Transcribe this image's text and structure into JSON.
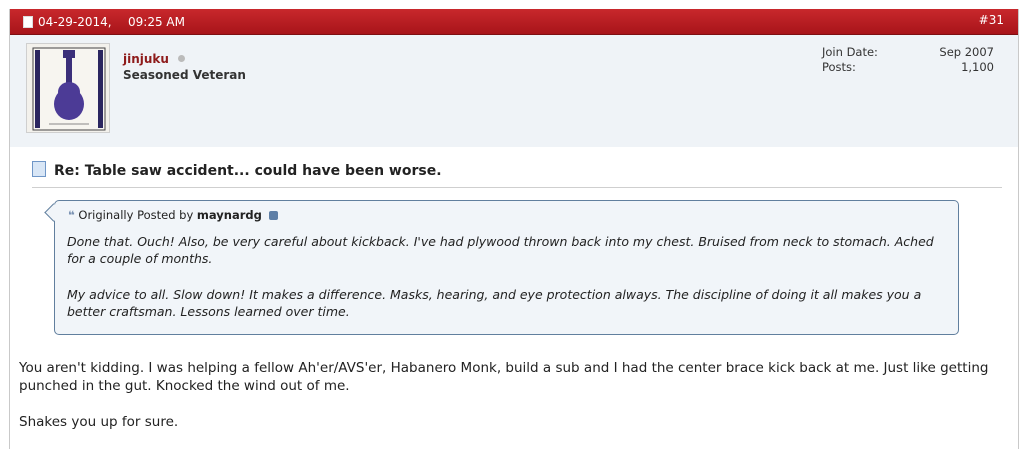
{
  "post": {
    "date": "04-29-2014,",
    "time": "09:25 AM",
    "number": "#31"
  },
  "user": {
    "name": "jinjuku",
    "title": "Seasoned Veteran",
    "stats": [
      {
        "label": "Join Date:",
        "value": "Sep 2007"
      },
      {
        "label": "Posts:",
        "value": "1,100"
      }
    ]
  },
  "thread_title": "Re: Table saw accident... could have been worse.",
  "quote": {
    "prefix": "Originally Posted by",
    "author": "maynardg",
    "paragraphs": [
      "Done that. Ouch! Also, be very careful about kickback. I've had plywood thrown back into my chest. Bruised from neck to stomach. Ached for a couple of months.",
      "My advice to all. Slow down! It makes a difference. Masks, hearing, and eye protection always. The discipline of doing it all makes you a better craftsman. Lessons learned over time."
    ]
  },
  "message": {
    "paragraphs": [
      "You aren't kidding. I was helping a fellow Ah'er/AVS'er, Habanero Monk, build a sub and I had the center brace kick back at me. Just like getting punched in the gut. Knocked the wind out of me.",
      "Shakes you up for sure."
    ]
  },
  "colors": {
    "header": "#b81d22",
    "username": "#8e1b1b",
    "quote_border": "#617f9e"
  }
}
